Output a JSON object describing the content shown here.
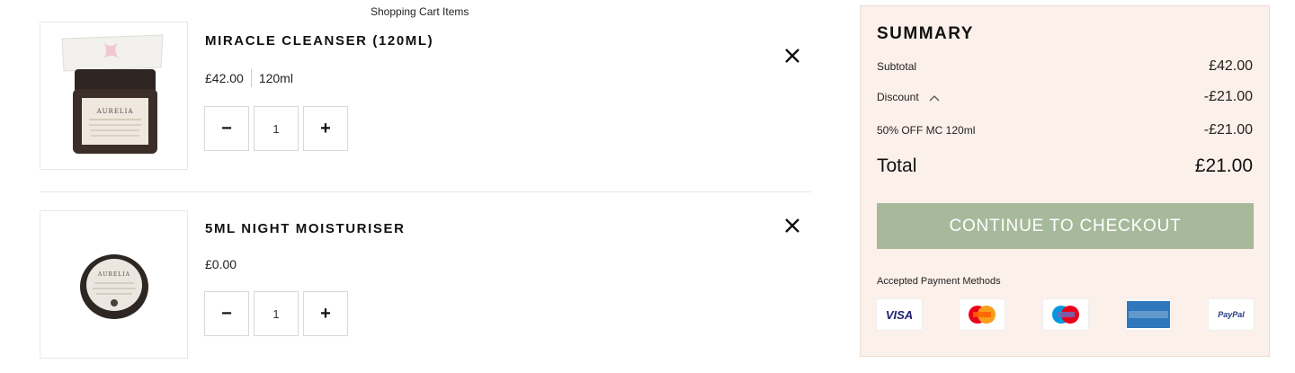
{
  "cart": {
    "heading": "Shopping Cart Items",
    "items": [
      {
        "name": "MIRACLE CLEANSER (120ML)",
        "price": "£42.00",
        "size": "120ml",
        "quantity": "1",
        "minus": "−",
        "plus": "+",
        "image_icon": "cleanser-jar-icon",
        "image_brand": "AURELIA"
      },
      {
        "name": "5ML NIGHT MOISTURISER",
        "price": "£0.00",
        "quantity": "1",
        "minus": "−",
        "plus": "+",
        "image_icon": "moisturiser-tin-icon",
        "image_brand": "AURELIA"
      }
    ],
    "remove_icon": "close-icon"
  },
  "summary": {
    "title": "SUMMARY",
    "subtotal_label": "Subtotal",
    "subtotal_value": "£42.00",
    "discount_label": "Discount",
    "discount_value": "-£21.00",
    "promo_label": "50% OFF MC 120ml",
    "promo_value": "-£21.00",
    "total_label": "Total",
    "total_value": "£21.00",
    "checkout_label": "CONTINUE TO CHECKOUT",
    "payment_label": "Accepted Payment Methods",
    "payment_methods": [
      "VISA",
      "MasterCard",
      "Maestro",
      "AMERICAN EXPRESS",
      "PayPal"
    ]
  },
  "colors": {
    "accent_green": "#a6ba9b",
    "summary_bg": "#fcf0ea"
  }
}
